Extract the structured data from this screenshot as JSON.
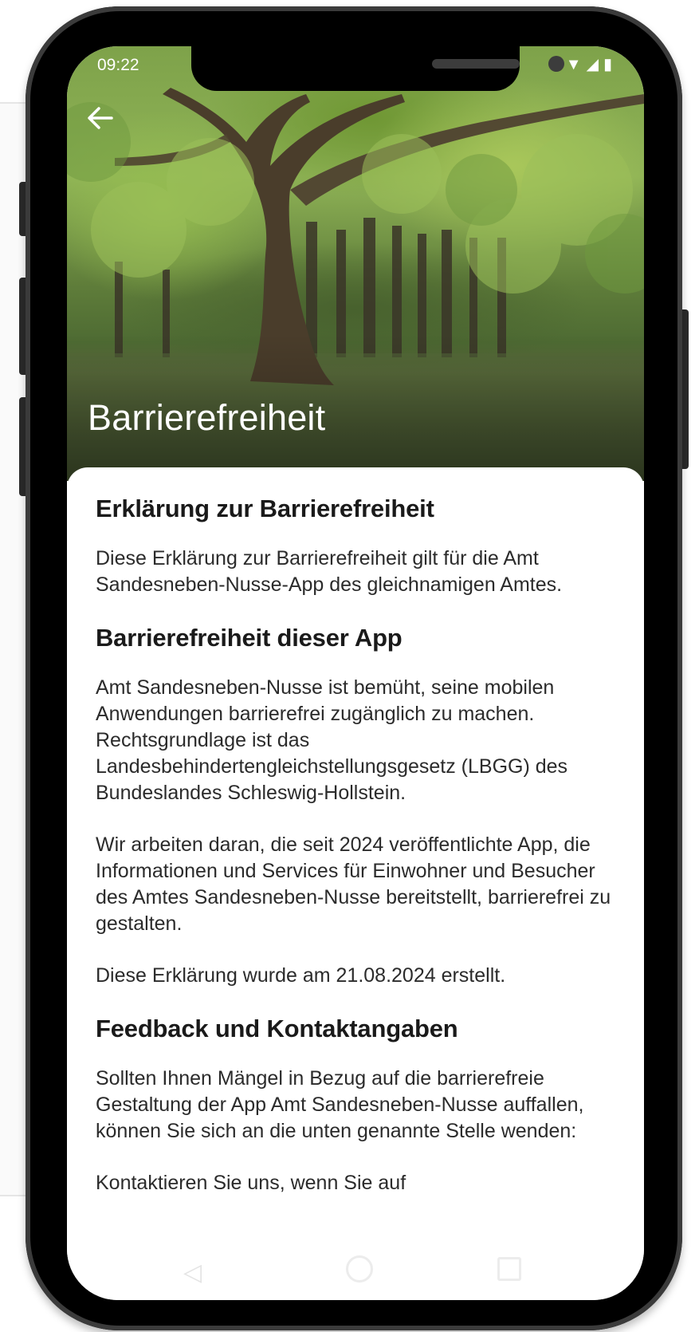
{
  "status_bar": {
    "time": "09:22",
    "icons": [
      "wifi-icon",
      "signal-icon",
      "battery-icon"
    ]
  },
  "header": {
    "back_icon": "arrow-left-icon",
    "title": "Barrierefreiheit"
  },
  "content": {
    "sections": [
      {
        "heading": "Erklärung zur Barrierefreiheit",
        "paragraphs": [
          "Diese Erklärung zur Barrierefreiheit gilt für die Amt Sandesneben-Nusse-App des gleichnamigen Amtes."
        ]
      },
      {
        "heading": "Barrierefreiheit dieser App",
        "paragraphs": [
          "Amt Sandesneben-Nusse ist bemüht, seine mobilen Anwendungen barrierefrei zugänglich zu machen. Rechtsgrundlage ist das Landesbehindertengleichstellungsgesetz (LBGG) des Bundeslandes Schleswig-Hollstein.",
          "Wir arbeiten daran, die seit 2024 veröffentlichte App, die Informationen und Services für Einwohner und Besucher des Amtes Sandesneben-Nusse bereitstellt, barrierefrei zu gestalten.",
          "Diese Erklärung wurde am 21.08.2024 erstellt."
        ]
      },
      {
        "heading": "Feedback und Kontaktangaben",
        "paragraphs": [
          "Sollten Ihnen Mängel in Bezug auf die barrierefreie Gestaltung der App Amt Sandesneben-Nusse auffallen, können Sie sich an die unten genannte Stelle wenden:",
          "Kontaktieren Sie uns, wenn Sie auf"
        ]
      }
    ]
  },
  "nav_bar": {
    "icons": [
      "nav-back-icon",
      "nav-home-icon",
      "nav-recents-icon"
    ]
  },
  "colors": {
    "phone_frame": "#000000",
    "card_background": "#ffffff",
    "heading_text": "#1a1a1a",
    "body_text": "#2b2b2b",
    "hero_title_text": "#ffffff"
  }
}
